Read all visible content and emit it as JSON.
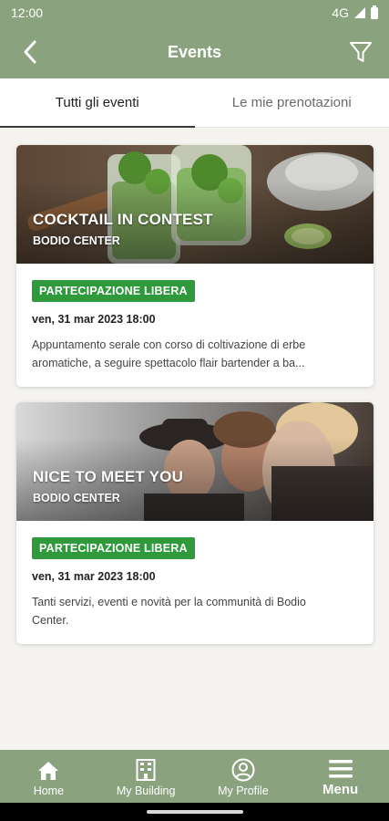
{
  "status_bar": {
    "time": "12:00",
    "network": "4G"
  },
  "app_bar": {
    "title": "Events"
  },
  "tabs": [
    {
      "label": "Tutti gli eventi",
      "active": true
    },
    {
      "label": "Le mie prenotazioni",
      "active": false
    }
  ],
  "events": [
    {
      "title": "COCKTAIL IN CONTEST",
      "location": "BODIO CENTER",
      "badge": "PARTECIPAZIONE LIBERA",
      "date": "ven, 31 mar 2023 18:00",
      "description_line1": "Appuntamento serale con corso di coltivazione di erbe",
      "description_line2": "aromatiche, a seguire spettacolo flair bartender a ba..."
    },
    {
      "title": "NICE TO MEET YOU",
      "location": "BODIO CENTER",
      "badge": "PARTECIPAZIONE LIBERA",
      "date": "ven, 31 mar 2023 18:00",
      "description_line1": "Tanti servizi, eventi e novità per la communità di Bodio",
      "description_line2": "Center."
    }
  ],
  "bottom_nav": [
    {
      "label": "Home",
      "icon": "home-icon"
    },
    {
      "label": "My Building",
      "icon": "building-icon"
    },
    {
      "label": "My Profile",
      "icon": "profile-icon"
    },
    {
      "label": "Menu",
      "icon": "menu-icon"
    }
  ],
  "colors": {
    "accent": "#8aa37e",
    "badge": "#2f9a3c"
  }
}
